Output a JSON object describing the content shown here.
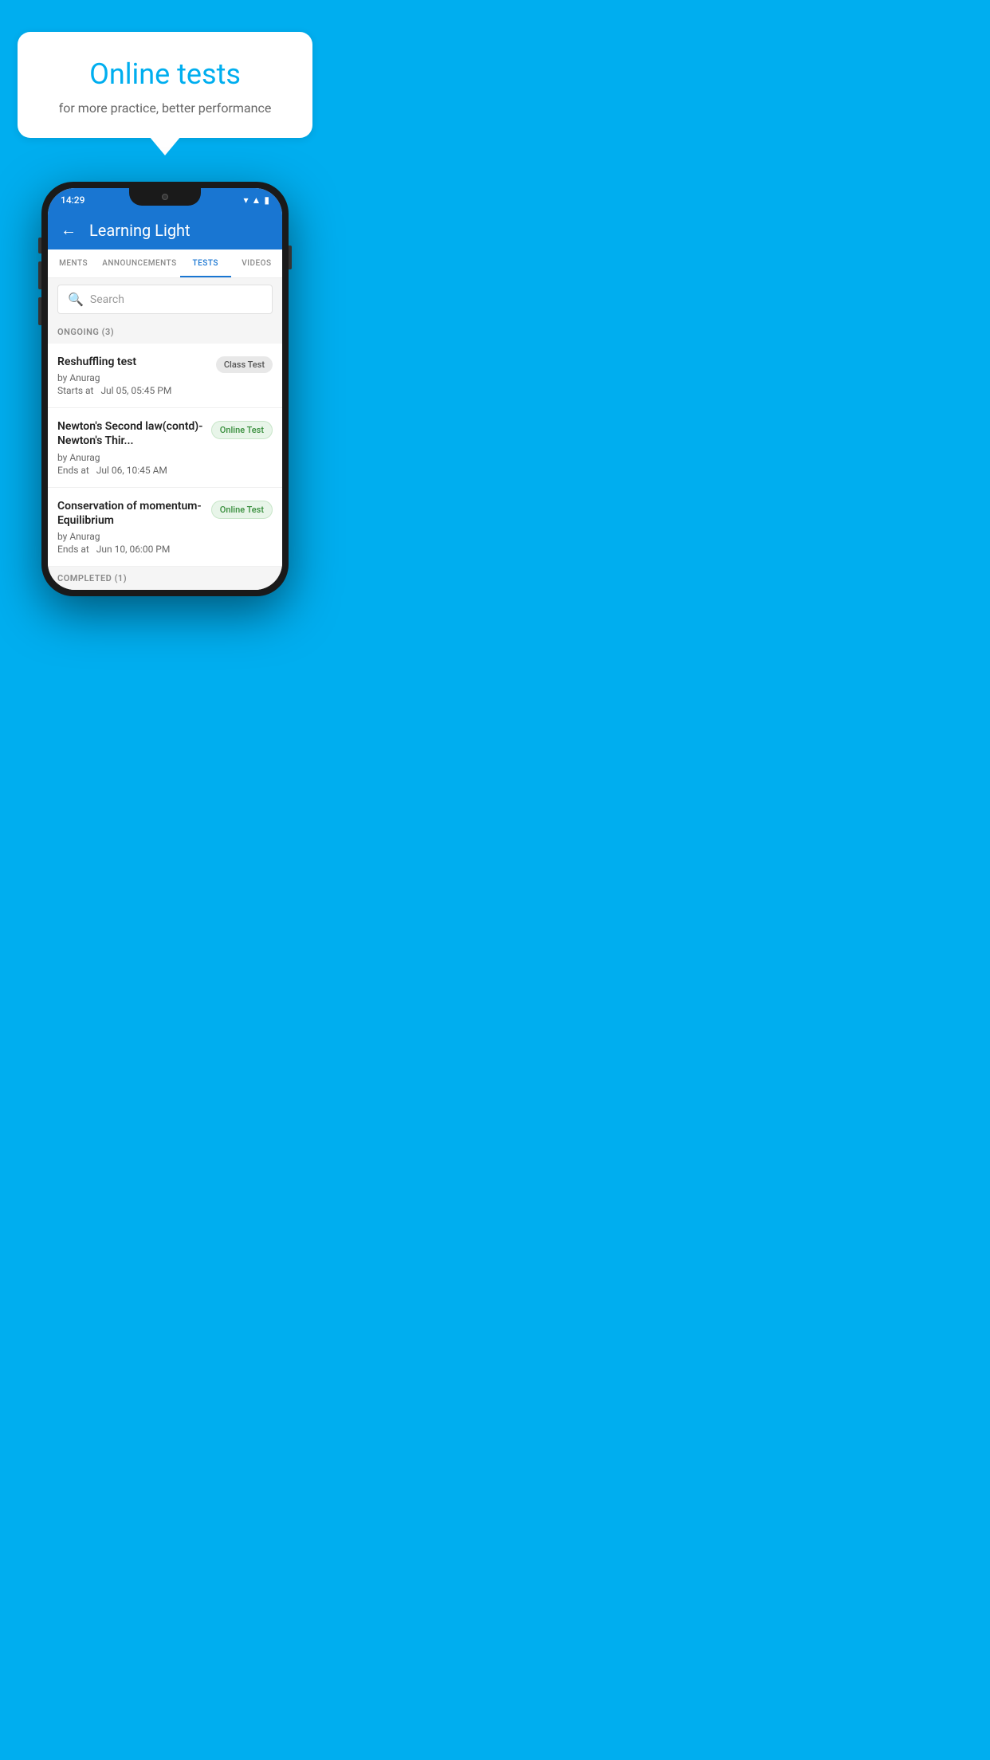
{
  "background": {
    "color": "#00AEEF"
  },
  "speech_bubble": {
    "title": "Online tests",
    "subtitle": "for more practice, better performance"
  },
  "phone": {
    "status_bar": {
      "time": "14:29",
      "wifi": "▾",
      "signal": "▲",
      "battery": "▮"
    },
    "app_header": {
      "back_label": "←",
      "title": "Learning Light"
    },
    "tabs": [
      {
        "label": "MENTS",
        "active": false
      },
      {
        "label": "ANNOUNCEMENTS",
        "active": false
      },
      {
        "label": "TESTS",
        "active": true
      },
      {
        "label": "VIDEOS",
        "active": false
      }
    ],
    "search": {
      "placeholder": "Search"
    },
    "ongoing_section": {
      "label": "ONGOING (3)"
    },
    "test_items": [
      {
        "name": "Reshuffling test",
        "author": "by Anurag",
        "date_label": "Starts at",
        "date_value": "Jul 05, 05:45 PM",
        "badge": "Class Test",
        "badge_type": "class"
      },
      {
        "name": "Newton's Second law(contd)-Newton's Thir...",
        "author": "by Anurag",
        "date_label": "Ends at",
        "date_value": "Jul 06, 10:45 AM",
        "badge": "Online Test",
        "badge_type": "online"
      },
      {
        "name": "Conservation of momentum-Equilibrium",
        "author": "by Anurag",
        "date_label": "Ends at",
        "date_value": "Jun 10, 06:00 PM",
        "badge": "Online Test",
        "badge_type": "online"
      }
    ],
    "completed_section": {
      "label": "COMPLETED (1)"
    }
  }
}
